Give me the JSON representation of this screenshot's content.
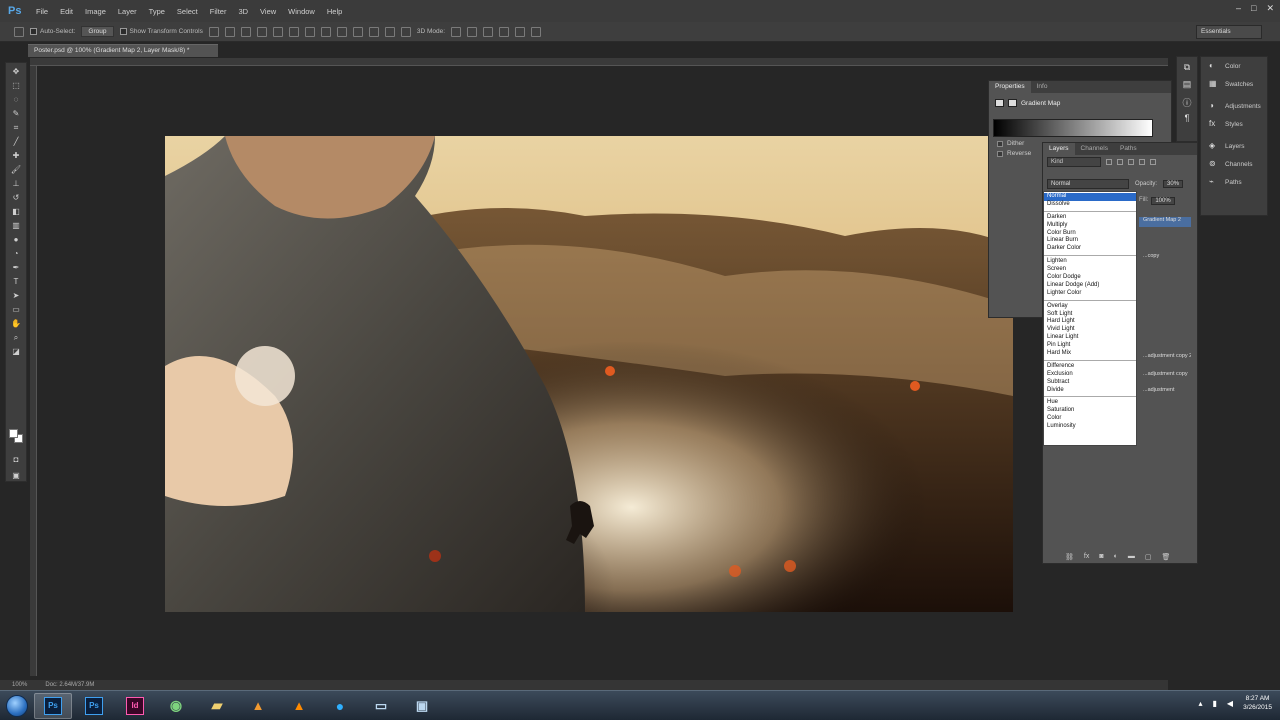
{
  "app": {
    "logo": "Ps"
  },
  "menu": [
    "File",
    "Edit",
    "Image",
    "Layer",
    "Type",
    "Select",
    "Filter",
    "3D",
    "View",
    "Window",
    "Help"
  ],
  "options": {
    "auto_select": "Auto-Select:",
    "group": "Group",
    "show_transform": "Show Transform Controls",
    "mode_3d": "3D Mode:",
    "workspace": "Essentials"
  },
  "document": {
    "tab_title": "Poster.psd @ 100% (Gradient Map 2, Layer Mask/8) *",
    "zoom": "100%",
    "doc_size": "Doc: 2.64M/37.9M"
  },
  "properties": {
    "tabs": [
      "Properties",
      "Info"
    ],
    "title": "Gradient Map",
    "dither": "Dither",
    "reverse": "Reverse"
  },
  "layers": {
    "tabs": [
      "Layers",
      "Channels",
      "Paths"
    ],
    "kind": "Kind",
    "blend_mode": "Normal",
    "opacity_label": "Opacity:",
    "opacity_value": "30%",
    "fill_label": "Fill:",
    "fill_value": "100%",
    "rows": [
      "Gradient Map 2",
      "...copy",
      "...adjustment copy 2",
      "...adjustment copy",
      "...adjustment"
    ]
  },
  "blend_modes": {
    "group1": [
      "Normal",
      "Dissolve"
    ],
    "group2": [
      "Darken",
      "Multiply",
      "Color Burn",
      "Linear Burn",
      "Darker Color"
    ],
    "group3": [
      "Lighten",
      "Screen",
      "Color Dodge",
      "Linear Dodge (Add)",
      "Lighter Color"
    ],
    "group4": [
      "Overlay",
      "Soft Light",
      "Hard Light",
      "Vivid Light",
      "Linear Light",
      "Pin Light",
      "Hard Mix"
    ],
    "group5": [
      "Difference",
      "Exclusion",
      "Subtract",
      "Divide"
    ],
    "group6": [
      "Hue",
      "Saturation",
      "Color",
      "Luminosity"
    ]
  },
  "right_dock": {
    "group1": [
      "Color",
      "Swatches"
    ],
    "group2": [
      "Adjustments",
      "Styles"
    ],
    "group3": [
      "Layers",
      "Channels",
      "Paths"
    ]
  },
  "taskbar": {
    "time": "8:27 AM",
    "date": "3/26/2015"
  },
  "colors": {
    "accent_selection": "#2a6ac8",
    "panel": "#535353",
    "app_bg": "#262626"
  }
}
